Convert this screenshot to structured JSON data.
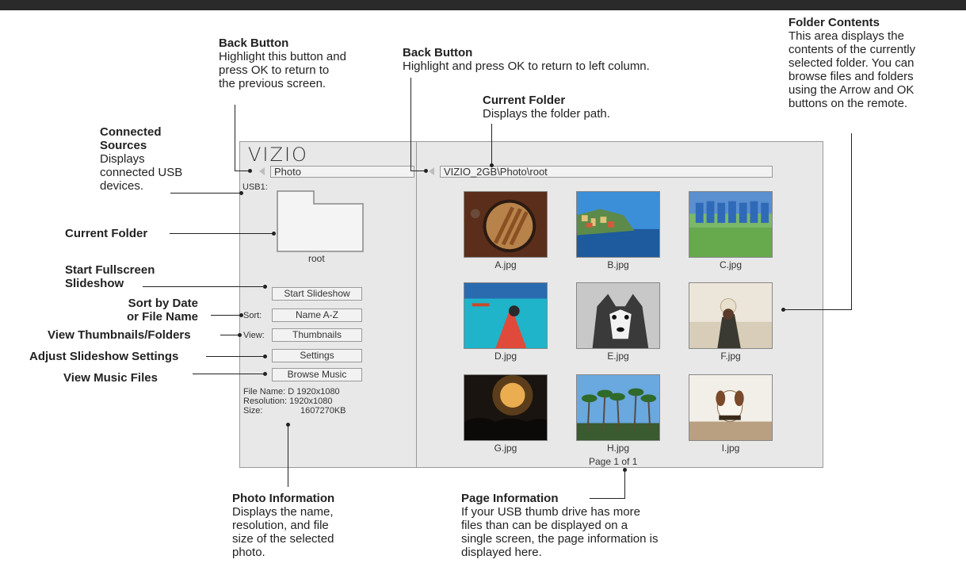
{
  "tv": {
    "logo": "VIZIO",
    "left_nav_label": "Photo",
    "right_nav_path": "VIZIO_2GB\\Photo\\root",
    "source_label": "USB1:",
    "folder_name": "root",
    "buttons": {
      "start_slideshow": "Start Slideshow",
      "sort_label": "Sort:",
      "sort_value": "Name A-Z",
      "view_label": "View:",
      "view_value": "Thumbnails",
      "settings": "Settings",
      "browse_music": "Browse Music"
    },
    "photo_info": {
      "file_name": "File Name: D 1920x1080",
      "resolution": "Resolution: 1920x1080",
      "size_label": "Size:",
      "size_value": "1607270KB"
    },
    "thumbnails": [
      "A.jpg",
      "B.jpg",
      "C.jpg",
      "D.jpg",
      "E.jpg",
      "F.jpg",
      "G.jpg",
      "H.jpg",
      "I.jpg"
    ],
    "page_info": "Page 1 of 1"
  },
  "annotations": {
    "back_left": {
      "title": "Back Button",
      "lines": [
        "Highlight this button and",
        "press OK to return to",
        "the previous screen."
      ]
    },
    "back_right": {
      "title": "Back Button",
      "text": "Highlight and press OK to return to left column."
    },
    "current_folder_path": {
      "title": "Current Folder",
      "text": "Displays the folder path."
    },
    "folder_contents": {
      "title": "Folder Contents",
      "lines": [
        "This area displays the",
        "contents of the currently",
        "selected folder. You can",
        "browse files and folders",
        "using the Arrow and OK",
        "buttons on the remote."
      ]
    },
    "connected_sources": {
      "title1": "Connected",
      "title2": "Sources",
      "lines": [
        "Displays",
        "connected USB",
        "devices."
      ]
    },
    "current_folder": "Current Folder",
    "start_fullscreen": [
      "Start Fullscreen",
      "Slideshow"
    ],
    "sort": [
      "Sort by Date",
      "or File Name"
    ],
    "view": "View Thumbnails/Folders",
    "settings": "Adjust Slideshow Settings",
    "music": "View Music Files",
    "photo_information": {
      "title": "Photo Information",
      "lines": [
        "Displays the name,",
        "resolution, and file",
        "size of the selected",
        "photo."
      ]
    },
    "page_information": {
      "title": "Page Information",
      "lines": [
        "If your USB thumb drive has more",
        "files than can be displayed on a",
        "single screen, the page information is",
        "displayed here."
      ]
    }
  },
  "colors": {
    "screen_bg": "#e8e8e8",
    "border": "#9a9a9a",
    "topbar": "#2a2a2a"
  }
}
